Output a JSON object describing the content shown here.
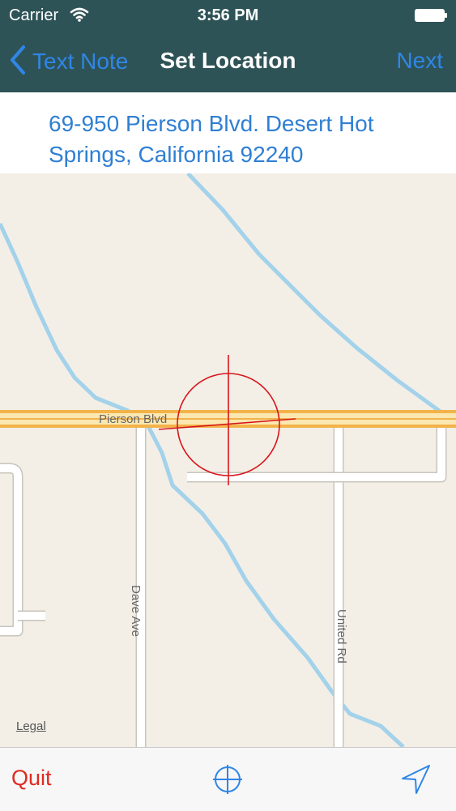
{
  "status_bar": {
    "carrier": "Carrier",
    "time": "3:56 PM"
  },
  "nav": {
    "back_label": "Text Note",
    "title": "Set Location",
    "next_label": "Next"
  },
  "address": {
    "text": "69-950 Pierson Blvd. Desert Hot Springs, California 92240"
  },
  "map": {
    "road_labels": {
      "pierson": "Pierson Blvd",
      "dave": "Dave Ave",
      "united": "United Rd"
    },
    "legal": "Legal"
  },
  "toolbar": {
    "quit_label": "Quit"
  },
  "colors": {
    "nav_background": "#2e5357",
    "accent_blue": "#2f86e6",
    "quit_red": "#e02a20",
    "crosshair_red": "#d8151b",
    "water_blue": "#a3d2ea",
    "road_orange": "#f2b34a"
  },
  "icons": {
    "back": "chevron-left-icon",
    "wifi": "wifi-icon",
    "battery": "battery-icon",
    "crosshair": "crosshair-target-icon",
    "locate": "crosshair-locate-icon",
    "track": "location-arrow-icon"
  }
}
